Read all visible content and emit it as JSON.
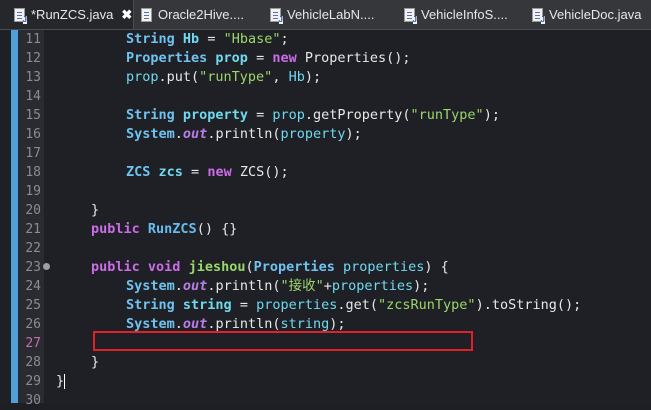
{
  "tabs": [
    {
      "label": "*RunZCS.java",
      "active": true,
      "icon": "java-file-icon",
      "close": "✖"
    },
    {
      "label": "Oracle2Hive....",
      "icon": "file-icon"
    },
    {
      "label": "VehicleLabN....",
      "icon": "java-file-icon"
    },
    {
      "label": "VehicleInfoS....",
      "icon": "java-file-icon"
    },
    {
      "label": "VehicleDoc.java",
      "icon": "java-file-icon"
    }
  ],
  "editor": {
    "line_numbers": [
      "11",
      "12",
      "13",
      "14",
      "15",
      "16",
      "17",
      "18",
      "19",
      "20",
      "21",
      "22",
      "23",
      "24",
      "25",
      "26",
      "27",
      "28",
      "29",
      "30"
    ],
    "lines": {
      "l11": {
        "t1": "String",
        "t2": "Hb",
        "t3": " = ",
        "t4": "\"Hbase\"",
        "t5": ";"
      },
      "l12": {
        "t1": "Properties",
        "t2": "prop",
        "t3": " = ",
        "t4": "new",
        "t5": " Properties();"
      },
      "l13": {
        "t1": "prop",
        "t2": ".put(",
        "t3": "\"runType\"",
        "t4": ", ",
        "t5": "Hb",
        "t6": ");"
      },
      "l15": {
        "t1": "String",
        "t2": "property",
        "t3": " = ",
        "t4": "prop",
        "t5": ".getProperty(",
        "t6": "\"runType\"",
        "t7": ");"
      },
      "l16": {
        "t1": "System",
        "t2": ".",
        "t3": "out",
        "t4": ".println(",
        "t5": "property",
        "t6": ");"
      },
      "l18": {
        "t1": "ZCS",
        "t2": "zcs",
        "t3": " = ",
        "t4": "new",
        "t5": " ZCS();"
      },
      "l20": {
        "t1": "}"
      },
      "l21": {
        "t1": "public",
        "t2": "RunZCS",
        "t3": "() {}"
      },
      "l23": {
        "t1": "public",
        "t2": "void",
        "t3": "jieshou",
        "t4": "(",
        "t5": "Properties",
        "t6": "properties",
        "t7": ") {"
      },
      "l24": {
        "t1": "System",
        "t2": ".",
        "t3": "out",
        "t4": ".println(",
        "t5": "\"接收\"",
        "t6": "+",
        "t7": "properties",
        "t8": ");"
      },
      "l25": {
        "t1": "String",
        "t2": "string",
        "t3": " = ",
        "t4": "properties",
        "t5": ".get(",
        "t6": "\"zcsRunType\"",
        "t7": ").toString();"
      },
      "l26": {
        "t1": "System",
        "t2": ".",
        "t3": "out",
        "t4": ".println(",
        "t5": "string",
        "t6": ");"
      },
      "l28": {
        "t1": "}"
      },
      "l29": {
        "t1": "}"
      }
    }
  },
  "colors": {
    "highlight_box": "#e0202a",
    "change_strip": "#4f9fd8"
  }
}
